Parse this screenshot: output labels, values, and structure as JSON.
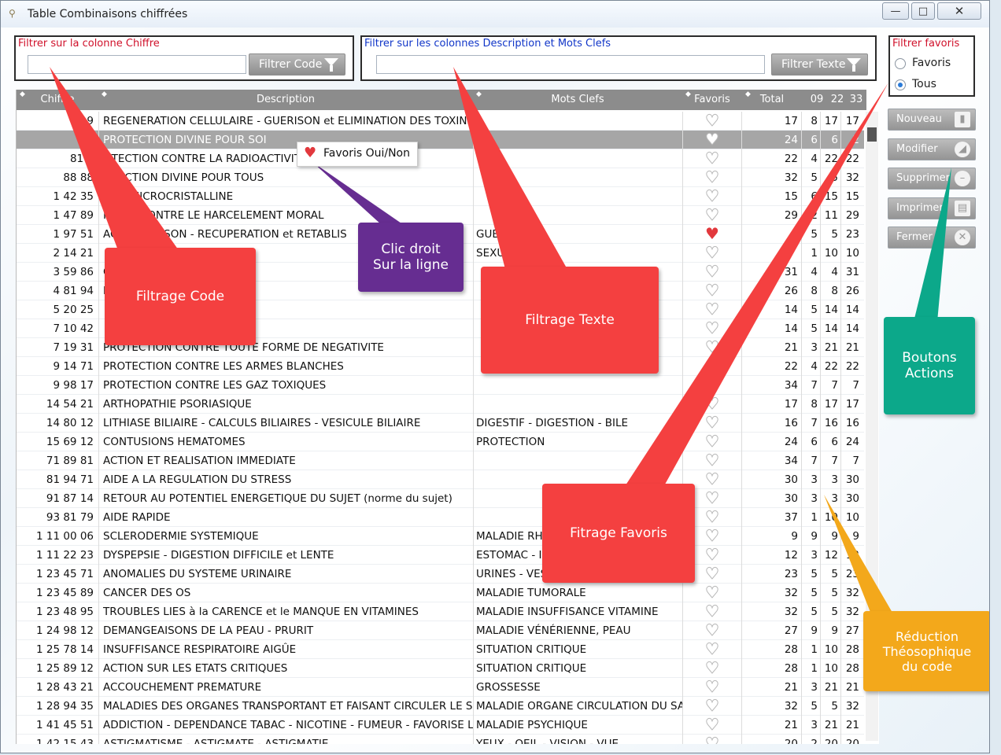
{
  "window": {
    "title": "Table Combinaisons chiffrées",
    "controls": {
      "minimize": "—",
      "maximize": "□",
      "close": "✕"
    }
  },
  "filters": {
    "code": {
      "label": "Filtrer sur la colonne Chiffre",
      "value": "",
      "button": "Filtrer Code"
    },
    "text": {
      "label": "Filtrer sur les colonnes Description et Mots Clefs",
      "value": "",
      "button": "Filtrer Texte"
    },
    "favorites": {
      "label": "Filtrer favoris",
      "options": [
        "Favoris",
        "Tous"
      ],
      "selected": "Tous"
    }
  },
  "table": {
    "columns": [
      "Chiffre",
      "Description",
      "Mots Clefs",
      "Favoris",
      "Total",
      "09",
      "22",
      "33"
    ],
    "rows": [
      {
        "code": "19",
        "desc": "REGENERATION CELLULAIRE - GUERISON et ELIMINATION DES TOXINES",
        "key": "",
        "fav": false,
        "total": "17",
        "n09": "8",
        "n22": "17",
        "n33": "17"
      },
      {
        "code": "8",
        "desc": "PROTECTION DIVINE POUR SOI",
        "key": "",
        "fav": false,
        "total": "24",
        "n09": "6",
        "n22": "6",
        "n33": "2",
        "selected": true
      },
      {
        "code": "81 4",
        "desc": "OTECTION CONTRE LA RADIOACTIVITE",
        "key": "",
        "fav": false,
        "total": "22",
        "n09": "4",
        "n22": "22",
        "n33": "22"
      },
      {
        "code": "88 88",
        "desc": "OTECTION DIVINE POUR TOUS",
        "key": "",
        "fav": false,
        "total": "32",
        "n09": "5",
        "n22": "5",
        "n33": "32"
      },
      {
        "code": "1 42 35",
        "desc": "A   TE MICROCRISTALLINE",
        "key": "",
        "fav": false,
        "total": "15",
        "n09": "6",
        "n22": "15",
        "n33": "15"
      },
      {
        "code": "1 47 89",
        "desc": "PR    ON CONTRE LE HARCELEMENT MORAL",
        "key": "",
        "fav": false,
        "total": "29",
        "n09": "2",
        "n22": "11",
        "n33": "29"
      },
      {
        "code": "1 97 51",
        "desc": "ACTI   GUERISON - RECUPERATION et RETABLIS",
        "key": "GUERIS",
        "fav": true,
        "total": "",
        "n09": "5",
        "n22": "5",
        "n33": "23"
      },
      {
        "code": "2 14 21",
        "desc": "",
        "key": "SEXUALI",
        "fav": false,
        "total": "",
        "n09": "1",
        "n22": "10",
        "n33": "10"
      },
      {
        "code": "3 59 86",
        "desc": "ON SUPERIEURE",
        "key": "",
        "fav": false,
        "total": "31",
        "n09": "4",
        "n22": "4",
        "n33": "31"
      },
      {
        "code": "4 81 94",
        "desc": "DE CICATRISATION SU",
        "key": "",
        "fav": false,
        "total": "26",
        "n09": "8",
        "n22": "8",
        "n33": "26"
      },
      {
        "code": "5 20 25",
        "desc": "",
        "key": "",
        "fav": false,
        "total": "14",
        "n09": "5",
        "n22": "14",
        "n33": "14"
      },
      {
        "code": "7 10 42",
        "desc": "",
        "key": "",
        "fav": false,
        "total": "14",
        "n09": "5",
        "n22": "14",
        "n33": "14"
      },
      {
        "code": "7 19 31",
        "desc": "PROTECTION CONTRE TOUTE FORME DE NEGATIVITE",
        "key": "",
        "fav": false,
        "total": "21",
        "n09": "3",
        "n22": "21",
        "n33": "21"
      },
      {
        "code": "9 14 71",
        "desc": "PROTECTION CONTRE LES ARMES BLANCHES",
        "key": "",
        "fav": false,
        "total": "22",
        "n09": "4",
        "n22": "22",
        "n33": "22"
      },
      {
        "code": "9 98 17",
        "desc": "PROTECTION CONTRE LES GAZ TOXIQUES",
        "key": "",
        "fav": false,
        "total": "34",
        "n09": "7",
        "n22": "7",
        "n33": "7"
      },
      {
        "code": "14 54 21",
        "desc": "ARTHOPATHIE PSORIASIQUE",
        "key": "",
        "fav": false,
        "total": "17",
        "n09": "8",
        "n22": "17",
        "n33": "17"
      },
      {
        "code": "14 80 12",
        "desc": "LITHIASE BILIAIRE - CALCULS BILIAIRES - VESICULE BILIAIRE",
        "key": "DIGESTIF - DIGESTION - BILE",
        "fav": false,
        "total": "16",
        "n09": "7",
        "n22": "16",
        "n33": "16"
      },
      {
        "code": "15 69 12",
        "desc": "CONTUSIONS HEMATOMES",
        "key": "PROTECTION",
        "fav": false,
        "total": "24",
        "n09": "6",
        "n22": "6",
        "n33": "24"
      },
      {
        "code": "71 89 81",
        "desc": "ACTION ET REALISATION IMMEDIATE",
        "key": "",
        "fav": false,
        "total": "34",
        "n09": "7",
        "n22": "7",
        "n33": "7"
      },
      {
        "code": "81 94 71",
        "desc": "AIDE A LA REGULATION DU STRESS",
        "key": "",
        "fav": false,
        "total": "30",
        "n09": "3",
        "n22": "3",
        "n33": "30"
      },
      {
        "code": "91 87 14",
        "desc": "RETOUR AU POTENTIEL ENERGETIQUE DU SUJET (norme du sujet)",
        "key": "",
        "fav": false,
        "total": "30",
        "n09": "3",
        "n22": "3",
        "n33": "30"
      },
      {
        "code": "93 81 79",
        "desc": "AIDE RAPIDE",
        "key": "",
        "fav": false,
        "total": "37",
        "n09": "1",
        "n22": "10",
        "n33": "10"
      },
      {
        "code": "1 11 00 06",
        "desc": "SCLERODERMIE SYSTEMIQUE",
        "key": "MALADIE RHU",
        "fav": false,
        "total": "9",
        "n09": "9",
        "n22": "9",
        "n33": "9"
      },
      {
        "code": "1 11 22 23",
        "desc": "DYSPEPSIE - DIGESTION DIFFICILE et LENTE",
        "key": "ESTOMAC - INT",
        "fav": false,
        "total": "12",
        "n09": "3",
        "n22": "12",
        "n33": "12"
      },
      {
        "code": "1 23 45 71",
        "desc": "ANOMALIES DU SYSTEME URINAIRE",
        "key": "URINES - VESS",
        "fav": false,
        "total": "23",
        "n09": "5",
        "n22": "5",
        "n33": "23"
      },
      {
        "code": "1 23 45 89",
        "desc": "CANCER DES OS",
        "key": "MALADIE TUMORALE",
        "fav": false,
        "total": "32",
        "n09": "5",
        "n22": "5",
        "n33": "32"
      },
      {
        "code": "1 23 48 95",
        "desc": "TROUBLES LIES à la CARENCE et le MANQUE EN VITAMINES",
        "key": "MALADIE INSUFFISANCE VITAMINE",
        "fav": false,
        "total": "32",
        "n09": "5",
        "n22": "5",
        "n33": "32"
      },
      {
        "code": "1 24 98 12",
        "desc": "DEMANGEAISONS DE LA PEAU - PRURIT",
        "key": "MALADIE VÉNÉRIENNE, PEAU",
        "fav": false,
        "total": "27",
        "n09": "9",
        "n22": "9",
        "n33": "27"
      },
      {
        "code": "1 25 78 14",
        "desc": "INSUFFISANCE RESPIRATOIRE AIGÛE",
        "key": "SITUATION CRITIQUE",
        "fav": false,
        "total": "28",
        "n09": "1",
        "n22": "10",
        "n33": "28"
      },
      {
        "code": "1 25 89 12",
        "desc": "ACTION SUR LES ETATS CRITIQUES",
        "key": "SITUATION CRITIQUE",
        "fav": false,
        "total": "28",
        "n09": "1",
        "n22": "10",
        "n33": "28"
      },
      {
        "code": "1 28 43 21",
        "desc": "ACCOUCHEMENT PREMATURE",
        "key": "GROSSESSE",
        "fav": false,
        "total": "21",
        "n09": "3",
        "n22": "21",
        "n33": "21"
      },
      {
        "code": "1 28 94 35",
        "desc": "MALADIES DES ORGANES TRANSPORTANT ET FAISANT CIRCULER LE SANG",
        "key": "MALADIE ORGANE CIRCULATION DU SANG",
        "fav": false,
        "total": "32",
        "n09": "5",
        "n22": "5",
        "n33": "32"
      },
      {
        "code": "1 41 45 51",
        "desc": "ADDICTION - DEPENDANCE TABAC - NICOTINE - FUMEUR - FAVORISE L'ARRET",
        "key": "MALADIE PSYCHIQUE",
        "fav": false,
        "total": "21",
        "n09": "3",
        "n22": "21",
        "n33": "21"
      },
      {
        "code": "1 42 15 43",
        "desc": "ASTIGMATISME - ASTIGMATE - ASTIGMATIE",
        "key": "YEUX - OEIL - VISION - VUE",
        "fav": false,
        "total": "20",
        "n09": "2",
        "n22": "20",
        "n33": "20"
      }
    ]
  },
  "actions": {
    "buttons": [
      "Nouveau",
      "Modifier",
      "Supprimer",
      "Imprimer",
      "Fermer"
    ]
  },
  "context_menu": {
    "label": "Favoris Oui/Non"
  },
  "callouts": {
    "code": "Filtrage Code",
    "click": [
      "Clic droit",
      "Sur la ligne"
    ],
    "text": "Filtrage Texte",
    "actions": [
      "Boutons",
      "Actions"
    ],
    "favorites": "Fitrage Favoris",
    "reduction": [
      "Réduction",
      "Théosophique",
      "du code"
    ]
  },
  "colors": {
    "callout_red": "#f44040",
    "callout_purple": "#662d91",
    "callout_green": "#0ca88a",
    "callout_orange": "#f3a81b",
    "header_gray": "#8c8c8c",
    "heart_red": "#e2383d"
  }
}
